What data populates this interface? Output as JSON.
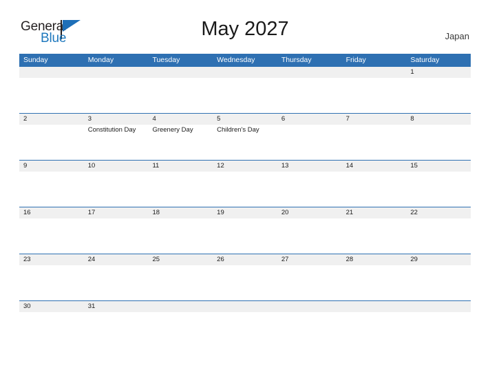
{
  "brand": {
    "name_part1": "General",
    "name_part2": "Blue",
    "triangle_color": "#1e6fb8",
    "text_color": "#231f20"
  },
  "header": {
    "title": "May 2027",
    "country": "Japan"
  },
  "theme": {
    "header_blue": "#2e70b2",
    "band_gray": "#f0f0f0",
    "text_dark": "#1a1a1a"
  },
  "calendar": {
    "weekdays": [
      "Sunday",
      "Monday",
      "Tuesday",
      "Wednesday",
      "Thursday",
      "Friday",
      "Saturday"
    ],
    "weeks": [
      {
        "days": [
          {
            "num": "",
            "empty": true,
            "events": []
          },
          {
            "num": "",
            "empty": true,
            "events": []
          },
          {
            "num": "",
            "empty": true,
            "events": []
          },
          {
            "num": "",
            "empty": true,
            "events": []
          },
          {
            "num": "",
            "empty": true,
            "events": []
          },
          {
            "num": "",
            "empty": true,
            "events": []
          },
          {
            "num": "1",
            "empty": false,
            "events": []
          }
        ]
      },
      {
        "days": [
          {
            "num": "2",
            "empty": false,
            "events": []
          },
          {
            "num": "3",
            "empty": false,
            "events": [
              "Constitution Day"
            ]
          },
          {
            "num": "4",
            "empty": false,
            "events": [
              "Greenery Day"
            ]
          },
          {
            "num": "5",
            "empty": false,
            "events": [
              "Children's Day"
            ]
          },
          {
            "num": "6",
            "empty": false,
            "events": []
          },
          {
            "num": "7",
            "empty": false,
            "events": []
          },
          {
            "num": "8",
            "empty": false,
            "events": []
          }
        ]
      },
      {
        "days": [
          {
            "num": "9",
            "empty": false,
            "events": []
          },
          {
            "num": "10",
            "empty": false,
            "events": []
          },
          {
            "num": "11",
            "empty": false,
            "events": []
          },
          {
            "num": "12",
            "empty": false,
            "events": []
          },
          {
            "num": "13",
            "empty": false,
            "events": []
          },
          {
            "num": "14",
            "empty": false,
            "events": []
          },
          {
            "num": "15",
            "empty": false,
            "events": []
          }
        ]
      },
      {
        "days": [
          {
            "num": "16",
            "empty": false,
            "events": []
          },
          {
            "num": "17",
            "empty": false,
            "events": []
          },
          {
            "num": "18",
            "empty": false,
            "events": []
          },
          {
            "num": "19",
            "empty": false,
            "events": []
          },
          {
            "num": "20",
            "empty": false,
            "events": []
          },
          {
            "num": "21",
            "empty": false,
            "events": []
          },
          {
            "num": "22",
            "empty": false,
            "events": []
          }
        ]
      },
      {
        "days": [
          {
            "num": "23",
            "empty": false,
            "events": []
          },
          {
            "num": "24",
            "empty": false,
            "events": []
          },
          {
            "num": "25",
            "empty": false,
            "events": []
          },
          {
            "num": "26",
            "empty": false,
            "events": []
          },
          {
            "num": "27",
            "empty": false,
            "events": []
          },
          {
            "num": "28",
            "empty": false,
            "events": []
          },
          {
            "num": "29",
            "empty": false,
            "events": []
          }
        ]
      },
      {
        "days": [
          {
            "num": "30",
            "empty": false,
            "events": []
          },
          {
            "num": "31",
            "empty": false,
            "events": []
          },
          {
            "num": "",
            "empty": true,
            "events": []
          },
          {
            "num": "",
            "empty": true,
            "events": []
          },
          {
            "num": "",
            "empty": true,
            "events": []
          },
          {
            "num": "",
            "empty": true,
            "events": []
          },
          {
            "num": "",
            "empty": true,
            "events": []
          }
        ]
      }
    ]
  }
}
